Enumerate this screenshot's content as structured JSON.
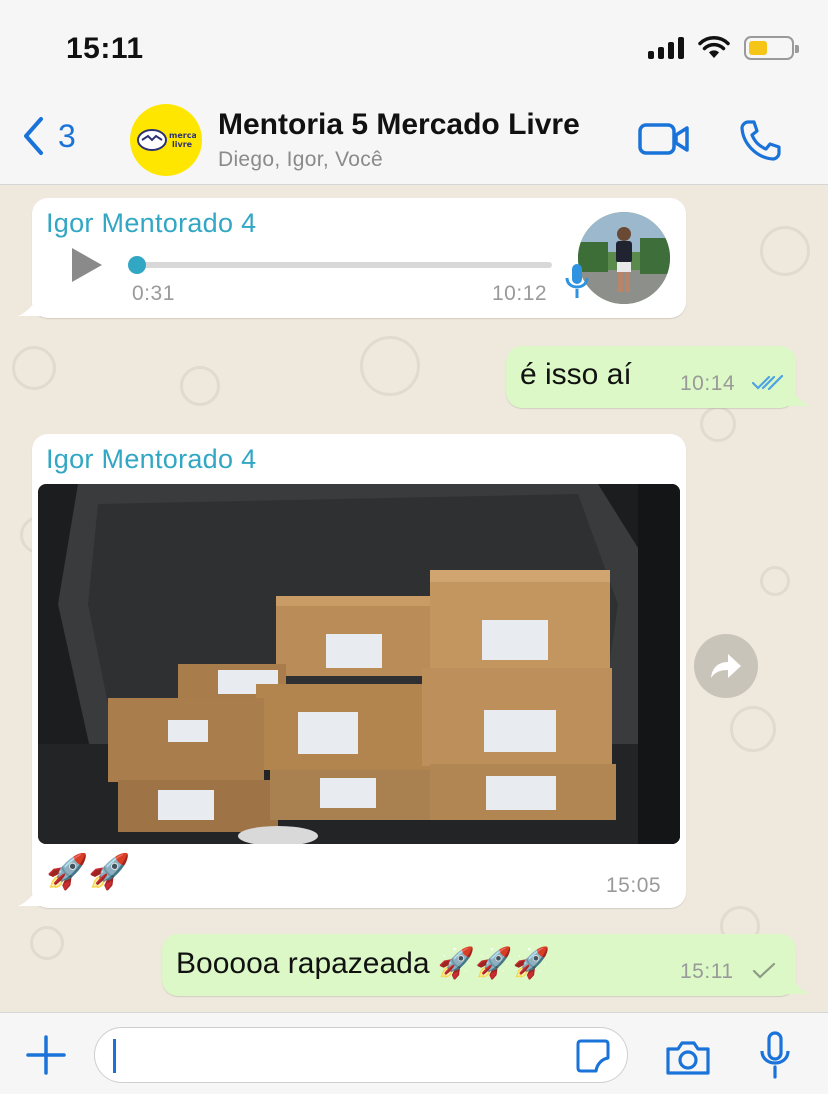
{
  "status_bar": {
    "time": "15:11",
    "battery_fill": 0.45,
    "battery_color": "#f5c518"
  },
  "header": {
    "back_count": "3",
    "group_avatar_logo_line1": "mercado",
    "group_avatar_logo_line2": "livre",
    "title": "Mentoria 5 Mercado Livre",
    "subtitle": "Diego, Igor, Você",
    "video_icon": "video-camera-icon",
    "call_icon": "phone-icon"
  },
  "messages": [
    {
      "type": "voice",
      "direction": "in",
      "sender": "Igor Mentorado 4",
      "duration": "0:31",
      "time": "10:12",
      "progress": 0.0
    },
    {
      "type": "text",
      "direction": "out",
      "text": "é isso aí",
      "time": "10:14",
      "status": "read"
    },
    {
      "type": "image",
      "direction": "in",
      "sender": "Igor Mentorado 4",
      "caption": "🚀🚀",
      "time": "15:05"
    },
    {
      "type": "text",
      "direction": "out",
      "text": "Booooa rapazeada 🚀🚀🚀",
      "time": "15:11",
      "status": "sent"
    }
  ],
  "composer": {
    "value": "",
    "placeholder": ""
  },
  "colors": {
    "accent": "#1a73d9",
    "sender_name": "#31a7c4",
    "outgoing_bubble": "#dbf8c6",
    "incoming_bubble": "#ffffff",
    "read_ticks": "#4fa3e3"
  }
}
